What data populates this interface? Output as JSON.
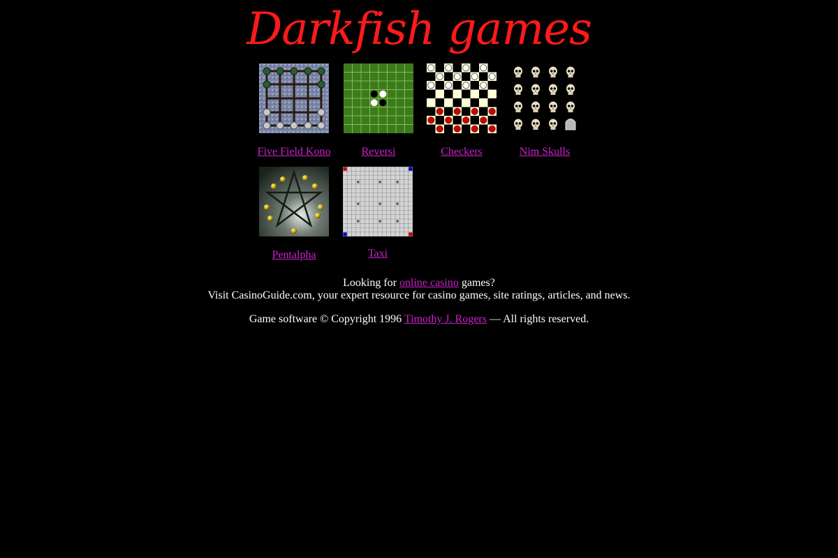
{
  "colors": {
    "background": "#000000",
    "text": "#ffffff",
    "link": "#cc22cc",
    "logo": "#ff1a1a"
  },
  "logo": {
    "text": "Darkfish games"
  },
  "games": [
    {
      "name": "Five Field Kono",
      "icon": "five-field-kono-board"
    },
    {
      "name": "Reversi",
      "icon": "reversi-board"
    },
    {
      "name": "Checkers",
      "icon": "checkers-board"
    },
    {
      "name": "Nim Skulls",
      "icon": "nim-skulls-grid"
    },
    {
      "name": "Pentalpha",
      "icon": "pentalpha-star"
    },
    {
      "name": "Taxi",
      "icon": "taxi-grid"
    }
  ],
  "promo": {
    "prefix": "Looking for",
    "link": "online casino",
    "suffix": "games?",
    "line2": "Visit CasinoGuide.com, your expert resource for casino games, site ratings, articles, and news."
  },
  "copyright": {
    "prefix": "Game software © Copyright 1996",
    "author": "Timothy J. Rogers",
    "dash": "—",
    "suffix": "All rights reserved."
  }
}
